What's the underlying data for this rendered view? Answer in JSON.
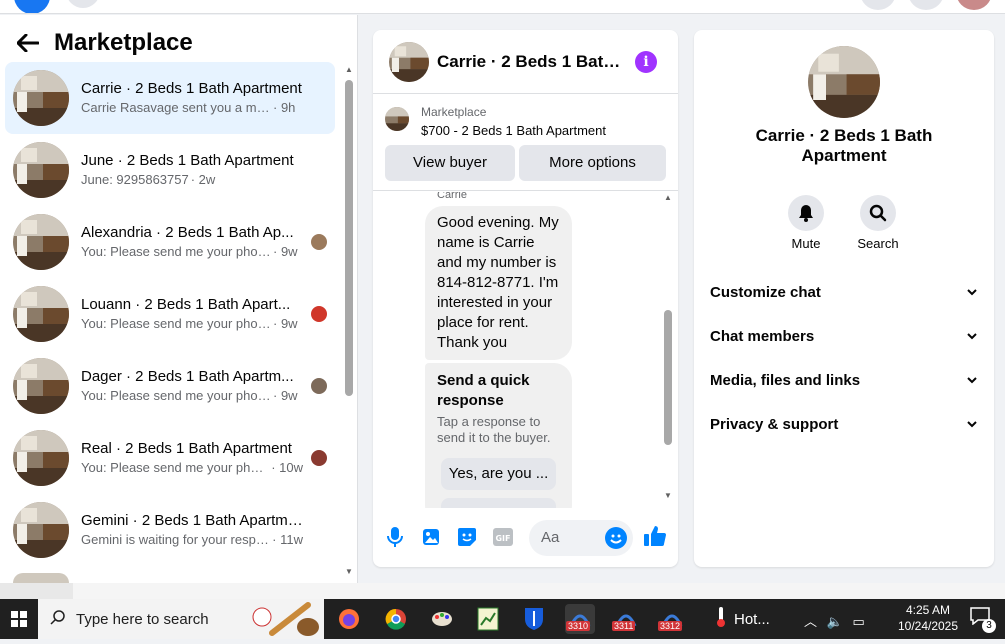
{
  "marketplace": {
    "title": "Marketplace",
    "conversations": [
      {
        "title": "Carrie · 2 Beds 1 Bath Apartment",
        "snippet": "Carrie Rasavage sent you a messag...",
        "time": "· 9h",
        "active": true
      },
      {
        "title": "June · 2 Beds 1 Bath Apartment",
        "snippet": "June: 9295863757",
        "time": "· 2w"
      },
      {
        "title": "Alexandria · 2 Beds 1 Bath Ap...",
        "snippet": "You: Please send me your phone...",
        "time": "· 9w"
      },
      {
        "title": "Louann · 2 Beds 1 Bath Apart...",
        "snippet": "You: Please send me your phone...",
        "time": "· 9w"
      },
      {
        "title": "Dager · 2 Beds 1 Bath Apartm...",
        "snippet": "You: Please send me your phone...",
        "time": "· 9w"
      },
      {
        "title": "Real · 2 Beds 1 Bath Apartment",
        "snippet": "You: Please send me your phon...",
        "time": "· 10w"
      },
      {
        "title": "Gemini · 2 Beds 1 Bath Apartment",
        "snippet": "Gemini is waiting for your respon...",
        "time": "· 11w"
      }
    ]
  },
  "chat": {
    "title": "Carrie · 2 Beds 1 Bath ...",
    "listing_source": "Marketplace",
    "listing_title": "$700 - 2 Beds 1 Bath Apartment",
    "view_buyer": "View buyer",
    "more_options": "More options",
    "sender": "Carrie",
    "message": "Good evening. My name is Carrie and my number is 814-812-8771. I'm interested in your place for rent. Thank you",
    "quick_title": "Send a quick response",
    "quick_sub": "Tap a response to send it to the buyer.",
    "quick_option": "Yes, are you ...",
    "input_placeholder": "Aa"
  },
  "info": {
    "name": "Carrie · 2 Beds 1 Bath Apartment",
    "mute": "Mute",
    "search": "Search",
    "sections": [
      "Customize chat",
      "Chat members",
      "Media, files and links",
      "Privacy & support"
    ]
  },
  "taskbar": {
    "search_placeholder": "Type here to search",
    "badges": [
      "3310",
      "3311",
      "3312"
    ],
    "weather": "Hot...",
    "time": "4:25 AM",
    "date": "10/24/2025",
    "notifications": "3"
  },
  "colors": {
    "accent": "#0084ff",
    "active_row": "#e7f3ff",
    "info_purple": "#a033ff"
  }
}
